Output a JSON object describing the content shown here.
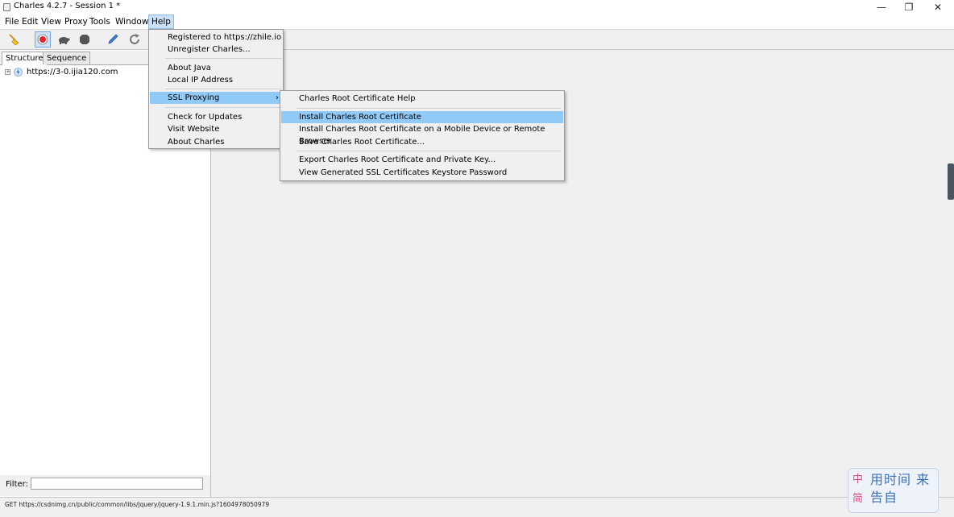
{
  "window": {
    "title": "Charles 4.2.7 - Session 1 *",
    "minimize_glyph": "—",
    "restore_glyph": "❐",
    "close_glyph": "✕"
  },
  "menubar": {
    "items": [
      "File",
      "Edit",
      "View",
      "Proxy",
      "Tools",
      "Window",
      "Help"
    ],
    "active": "Help"
  },
  "toolbar": {
    "icons": [
      "broom-icon",
      "record-icon",
      "throttle-turtle-icon",
      "breakpoint-icon",
      "pen-icon",
      "refresh-icon"
    ],
    "accent_record": "#e0242d"
  },
  "left_pane": {
    "tabs": [
      "Structure",
      "Sequence"
    ],
    "active_tab": "Structure",
    "tree": [
      {
        "label": "https://3-0.ijia120.com",
        "expanded": false
      }
    ],
    "filter_label": "Filter:",
    "filter_value": ""
  },
  "help_menu": {
    "items": [
      {
        "label": "Registered to https://zhile.io"
      },
      {
        "label": "Unregister Charles..."
      },
      {
        "label": "About Java"
      },
      {
        "label": "Local IP Address"
      },
      {
        "label": "SSL Proxying",
        "arrow": "›",
        "highlighted": true
      },
      {
        "label": "Check for Updates"
      },
      {
        "label": "Visit Website"
      },
      {
        "label": "About Charles"
      }
    ]
  },
  "ssl_menu": {
    "items": [
      {
        "label": "Charles Root Certificate Help"
      },
      {
        "label": "Install Charles Root Certificate",
        "highlighted": true
      },
      {
        "label": "Install Charles Root Certificate on a Mobile Device or Remote Browser"
      },
      {
        "label": "Save Charles Root Certificate..."
      },
      {
        "label": "Export Charles Root Certificate and Private Key..."
      },
      {
        "label": "View Generated SSL Certificates Keystore Password"
      }
    ]
  },
  "statusbar": {
    "text": "GET https://csdnimg.cn/public/common/libs/jquery/jquery-1.9.1.min.js?1604978050979"
  },
  "watermark": {
    "text_main": "用时间 来告自",
    "text_side": "中 简"
  },
  "colors": {
    "menu_highlight": "#91c9f7",
    "menubar_active": "#cce0f5"
  }
}
